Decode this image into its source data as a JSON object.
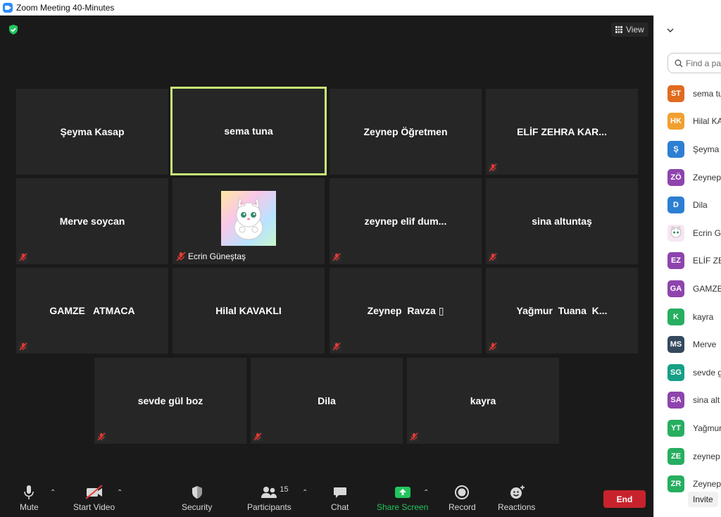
{
  "window": {
    "title": "Zoom Meeting 40-Minutes"
  },
  "top_controls": {
    "view_label": "View"
  },
  "tiles": [
    {
      "name": "Şeyma Kasap"
    },
    {
      "name": "sema tuna"
    },
    {
      "name": "Zeynep Öğretmen"
    },
    {
      "name": "ELİF ZEHRA KAR..."
    },
    {
      "name": "Merve soycan"
    },
    {
      "name": "Ecrin Güneştaş"
    },
    {
      "name": "zeynep  elif  dum..."
    },
    {
      "name": "sina altuntaş"
    },
    {
      "name": "GAMZE   ATMACA"
    },
    {
      "name": "Hilal KAVAKLI"
    },
    {
      "name": "Zeynep  Ravza ▯"
    },
    {
      "name": "Yağmur  Tuana  K..."
    },
    {
      "name": "sevde gül boz"
    },
    {
      "name": "Dila"
    },
    {
      "name": "kayra"
    }
  ],
  "toolbar": {
    "mute": "Mute",
    "start_video": "Start Video",
    "security": "Security",
    "participants": "Participants",
    "participants_count": "15",
    "chat": "Chat",
    "share_screen": "Share Screen",
    "record": "Record",
    "reactions": "Reactions",
    "end": "End"
  },
  "panel": {
    "search_placeholder": "Find a pa",
    "invite": "Invite",
    "participants": [
      {
        "initials": "ST",
        "name": "sema tu",
        "color": "#e06b1f"
      },
      {
        "initials": "HK",
        "name": "Hilal KA",
        "color": "#f0a030"
      },
      {
        "initials": "Ş",
        "name": "Şeyma",
        "color": "#2d7fd3"
      },
      {
        "initials": "ZÖ",
        "name": "Zeynep",
        "color": "#8e44ad"
      },
      {
        "initials": "D",
        "name": "Dila",
        "color": "#2d7fd3"
      },
      {
        "initials": "",
        "name": "Ecrin G",
        "color": "#f7e6f3"
      },
      {
        "initials": "EZ",
        "name": "ELİF ZE",
        "color": "#8e44ad"
      },
      {
        "initials": "GA",
        "name": "GAMZE",
        "color": "#8e44ad"
      },
      {
        "initials": "K",
        "name": "kayra",
        "color": "#27ae60"
      },
      {
        "initials": "MS",
        "name": "Merve",
        "color": "#34495e"
      },
      {
        "initials": "SG",
        "name": "sevde g",
        "color": "#16a085"
      },
      {
        "initials": "SA",
        "name": "sina alt",
        "color": "#8e44ad"
      },
      {
        "initials": "YT",
        "name": "Yağmur",
        "color": "#27ae60"
      },
      {
        "initials": "ZE",
        "name": "zeynep",
        "color": "#27ae60"
      },
      {
        "initials": "ZR",
        "name": "Zeynep",
        "color": "#27ae60"
      }
    ]
  }
}
